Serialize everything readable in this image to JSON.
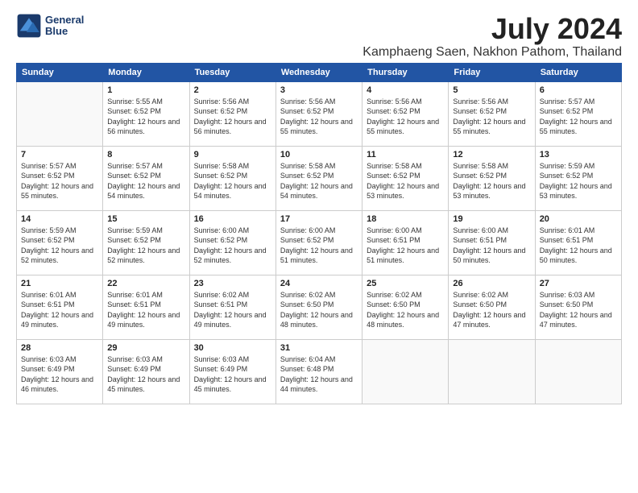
{
  "logo": {
    "line1": "General",
    "line2": "Blue"
  },
  "title": "July 2024",
  "subtitle": "Kamphaeng Saen, Nakhon Pathom, Thailand",
  "days_header": [
    "Sunday",
    "Monday",
    "Tuesday",
    "Wednesday",
    "Thursday",
    "Friday",
    "Saturday"
  ],
  "weeks": [
    [
      {
        "num": "",
        "sunrise": "",
        "sunset": "",
        "daylight": "",
        "empty": true
      },
      {
        "num": "1",
        "sunrise": "5:55 AM",
        "sunset": "6:52 PM",
        "daylight": "12 hours and 56 minutes."
      },
      {
        "num": "2",
        "sunrise": "5:56 AM",
        "sunset": "6:52 PM",
        "daylight": "12 hours and 56 minutes."
      },
      {
        "num": "3",
        "sunrise": "5:56 AM",
        "sunset": "6:52 PM",
        "daylight": "12 hours and 55 minutes."
      },
      {
        "num": "4",
        "sunrise": "5:56 AM",
        "sunset": "6:52 PM",
        "daylight": "12 hours and 55 minutes."
      },
      {
        "num": "5",
        "sunrise": "5:56 AM",
        "sunset": "6:52 PM",
        "daylight": "12 hours and 55 minutes."
      },
      {
        "num": "6",
        "sunrise": "5:57 AM",
        "sunset": "6:52 PM",
        "daylight": "12 hours and 55 minutes."
      }
    ],
    [
      {
        "num": "7",
        "sunrise": "5:57 AM",
        "sunset": "6:52 PM",
        "daylight": "12 hours and 55 minutes."
      },
      {
        "num": "8",
        "sunrise": "5:57 AM",
        "sunset": "6:52 PM",
        "daylight": "12 hours and 54 minutes."
      },
      {
        "num": "9",
        "sunrise": "5:58 AM",
        "sunset": "6:52 PM",
        "daylight": "12 hours and 54 minutes."
      },
      {
        "num": "10",
        "sunrise": "5:58 AM",
        "sunset": "6:52 PM",
        "daylight": "12 hours and 54 minutes."
      },
      {
        "num": "11",
        "sunrise": "5:58 AM",
        "sunset": "6:52 PM",
        "daylight": "12 hours and 53 minutes."
      },
      {
        "num": "12",
        "sunrise": "5:58 AM",
        "sunset": "6:52 PM",
        "daylight": "12 hours and 53 minutes."
      },
      {
        "num": "13",
        "sunrise": "5:59 AM",
        "sunset": "6:52 PM",
        "daylight": "12 hours and 53 minutes."
      }
    ],
    [
      {
        "num": "14",
        "sunrise": "5:59 AM",
        "sunset": "6:52 PM",
        "daylight": "12 hours and 52 minutes."
      },
      {
        "num": "15",
        "sunrise": "5:59 AM",
        "sunset": "6:52 PM",
        "daylight": "12 hours and 52 minutes."
      },
      {
        "num": "16",
        "sunrise": "6:00 AM",
        "sunset": "6:52 PM",
        "daylight": "12 hours and 52 minutes."
      },
      {
        "num": "17",
        "sunrise": "6:00 AM",
        "sunset": "6:52 PM",
        "daylight": "12 hours and 51 minutes."
      },
      {
        "num": "18",
        "sunrise": "6:00 AM",
        "sunset": "6:51 PM",
        "daylight": "12 hours and 51 minutes."
      },
      {
        "num": "19",
        "sunrise": "6:00 AM",
        "sunset": "6:51 PM",
        "daylight": "12 hours and 50 minutes."
      },
      {
        "num": "20",
        "sunrise": "6:01 AM",
        "sunset": "6:51 PM",
        "daylight": "12 hours and 50 minutes."
      }
    ],
    [
      {
        "num": "21",
        "sunrise": "6:01 AM",
        "sunset": "6:51 PM",
        "daylight": "12 hours and 49 minutes."
      },
      {
        "num": "22",
        "sunrise": "6:01 AM",
        "sunset": "6:51 PM",
        "daylight": "12 hours and 49 minutes."
      },
      {
        "num": "23",
        "sunrise": "6:02 AM",
        "sunset": "6:51 PM",
        "daylight": "12 hours and 49 minutes."
      },
      {
        "num": "24",
        "sunrise": "6:02 AM",
        "sunset": "6:50 PM",
        "daylight": "12 hours and 48 minutes."
      },
      {
        "num": "25",
        "sunrise": "6:02 AM",
        "sunset": "6:50 PM",
        "daylight": "12 hours and 48 minutes."
      },
      {
        "num": "26",
        "sunrise": "6:02 AM",
        "sunset": "6:50 PM",
        "daylight": "12 hours and 47 minutes."
      },
      {
        "num": "27",
        "sunrise": "6:03 AM",
        "sunset": "6:50 PM",
        "daylight": "12 hours and 47 minutes."
      }
    ],
    [
      {
        "num": "28",
        "sunrise": "6:03 AM",
        "sunset": "6:49 PM",
        "daylight": "12 hours and 46 minutes."
      },
      {
        "num": "29",
        "sunrise": "6:03 AM",
        "sunset": "6:49 PM",
        "daylight": "12 hours and 45 minutes."
      },
      {
        "num": "30",
        "sunrise": "6:03 AM",
        "sunset": "6:49 PM",
        "daylight": "12 hours and 45 minutes."
      },
      {
        "num": "31",
        "sunrise": "6:04 AM",
        "sunset": "6:48 PM",
        "daylight": "12 hours and 44 minutes."
      },
      {
        "num": "",
        "sunrise": "",
        "sunset": "",
        "daylight": "",
        "empty": true
      },
      {
        "num": "",
        "sunrise": "",
        "sunset": "",
        "daylight": "",
        "empty": true
      },
      {
        "num": "",
        "sunrise": "",
        "sunset": "",
        "daylight": "",
        "empty": true
      }
    ]
  ]
}
